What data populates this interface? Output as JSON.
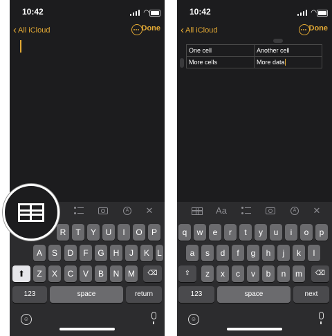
{
  "status": {
    "time": "10:42"
  },
  "nav": {
    "back_label": "All iCloud",
    "done_label": "Done"
  },
  "table": {
    "rows": [
      [
        "One cell",
        "Another cell"
      ],
      [
        "More cells",
        "More data"
      ]
    ]
  },
  "toolbar": {
    "format_label": "Aa",
    "icons": [
      "table-icon",
      "format-icon",
      "checklist-icon",
      "camera-icon",
      "markup-icon",
      "close-icon"
    ]
  },
  "keyboard": {
    "row2": [
      "A",
      "S",
      "D",
      "F",
      "G",
      "H",
      "J",
      "K",
      "L"
    ],
    "row3": [
      "Z",
      "X",
      "C",
      "V",
      "B",
      "N",
      "M"
    ],
    "left_row1_visible": [
      "R",
      "T",
      "Y",
      "U",
      "I",
      "O",
      "P"
    ],
    "right_row1": [
      "q",
      "w",
      "e",
      "r",
      "t",
      "y",
      "u",
      "i",
      "o",
      "p"
    ],
    "right_row2": [
      "a",
      "s",
      "d",
      "f",
      "g",
      "h",
      "j",
      "k",
      "l"
    ],
    "right_row3": [
      "z",
      "x",
      "c",
      "v",
      "b",
      "n",
      "m"
    ],
    "numbers_label": "123",
    "space_label": "space",
    "return_label": "return",
    "next_label": "next"
  },
  "colors": {
    "accent": "#e3a934",
    "background": "#1c1c1e",
    "keyboard": "#2c2c2e"
  }
}
